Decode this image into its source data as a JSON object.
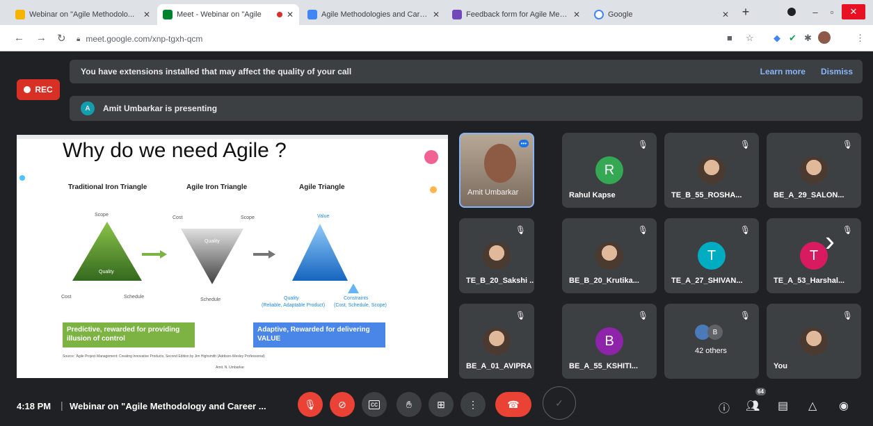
{
  "browser": {
    "tabs": [
      {
        "title": "Webinar on \"Agile Methodolo...",
        "color": "#f4b400"
      },
      {
        "title": "Meet - Webinar on \"Agile",
        "color": "#00832d"
      },
      {
        "title": "Agile Methodologies and Care...",
        "color": "#4285f4"
      },
      {
        "title": "Feedback form for Agile Meth...",
        "color": "#7248b9"
      },
      {
        "title": "Google",
        "color": "#4285f4"
      }
    ],
    "close_glyph": "✕",
    "new_tab": "+",
    "url": "meet.google.com/xnp-tgxh-qcm"
  },
  "meet": {
    "ext_banner": {
      "text": "You have extensions installed that may affect the quality of your call",
      "learn_more": "Learn more",
      "dismiss": "Dismiss"
    },
    "rec_label": "REC",
    "presenting": {
      "initial": "A",
      "text": "Amit Umbarkar is presenting"
    },
    "slide": {
      "title": "Why do we need Agile ?",
      "traditional": "Traditional Iron Triangle",
      "agile_iron": "Agile Iron Triangle",
      "agile_tri": "Agile Triangle",
      "scope": "Scope",
      "cost": "Cost",
      "schedule": "Schedule",
      "quality": "Quality",
      "value": "Value",
      "quality2": "Quality",
      "quality2_sub": "(Reliable, Adaptable Product)",
      "constraints": "Constraints",
      "constraints_sub": "(Cost, Schedule, Scope)",
      "box_left": "Predictive, rewarded for providing illusion of control",
      "box_right": "Adaptive, Rewarded for delivering VALUE",
      "source": "Source: 'Agile Project Management: Creating Innovative Products, Second Edition by Jim Highsmith (Addison-Wesley Professional)",
      "footer": "Amit. N. Umbarkar"
    },
    "participants": [
      {
        "name": "Amit Umbarkar",
        "type": "video"
      },
      {
        "name": "Rahul Kapse",
        "type": "initial",
        "initial": "R",
        "color": "#34a853"
      },
      {
        "name": "TE_B_55_ROSHA...",
        "type": "photo"
      },
      {
        "name": "BE_A_29_SALON...",
        "type": "photo"
      },
      {
        "name": "TE_B_20_Sakshi ...",
        "type": "photo"
      },
      {
        "name": "BE_B_20_Krutika...",
        "type": "photo"
      },
      {
        "name": "TE_A_27_SHIVAN...",
        "type": "initial",
        "initial": "T",
        "color": "#00acc1"
      },
      {
        "name": "TE_A_53_Harshal...",
        "type": "initial",
        "initial": "T",
        "color": "#d81b60"
      },
      {
        "name": "BE_A_01_AVIPRA ...",
        "type": "photo"
      },
      {
        "name": "BE_A_55_KSHITI...",
        "type": "initial",
        "initial": "B",
        "color": "#8e24aa"
      },
      {
        "name": "42 others",
        "type": "others",
        "initial": "B"
      },
      {
        "name": "You",
        "type": "photo"
      }
    ],
    "time": "4:18 PM",
    "meeting_title": "Webinar on \"Agile Methodology and Career ...",
    "people_count": "64"
  }
}
